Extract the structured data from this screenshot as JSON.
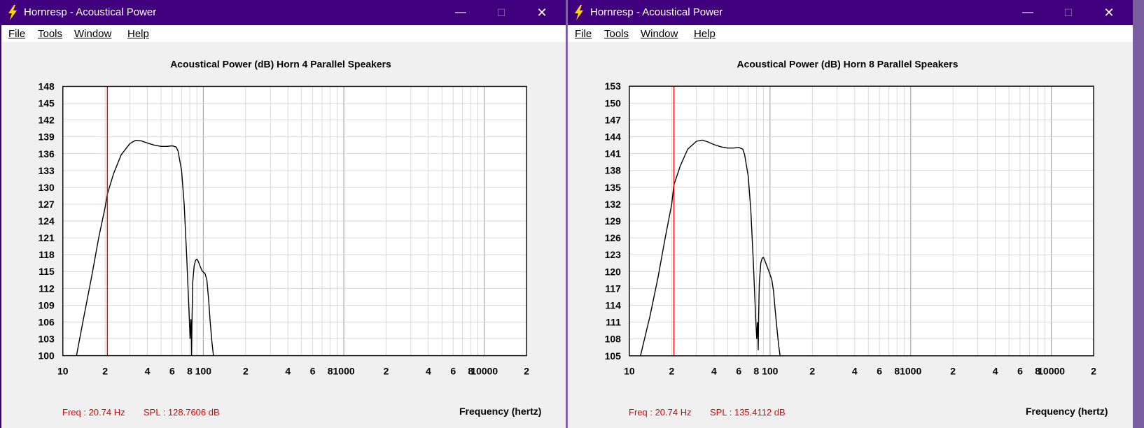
{
  "windows": [
    {
      "title": "Hornresp - Acoustical Power",
      "menu": [
        "File",
        "Tools",
        "Window",
        "Help"
      ],
      "freq_readout": "Freq : 20.74 Hz",
      "spl_readout": "SPL : 128.7606 dB",
      "chart_data": {
        "type": "line",
        "title": "Acoustical Power (dB)    Horn    4 Parallel Speakers",
        "xlabel": "Frequency (hertz)",
        "ylabel": "",
        "x_scale": "log",
        "xlim": [
          10,
          20000
        ],
        "ylim": [
          100,
          148
        ],
        "y_ticks": [
          100,
          103,
          106,
          109,
          112,
          115,
          118,
          121,
          124,
          127,
          130,
          133,
          136,
          139,
          142,
          145,
          148
        ],
        "x_tick_labels": [
          {
            "v": 10,
            "t": "10"
          },
          {
            "v": 20,
            "t": "2"
          },
          {
            "v": 40,
            "t": "4"
          },
          {
            "v": 60,
            "t": "6"
          },
          {
            "v": 80,
            "t": "8"
          },
          {
            "v": 100,
            "t": "100"
          },
          {
            "v": 200,
            "t": "2"
          },
          {
            "v": 400,
            "t": "4"
          },
          {
            "v": 600,
            "t": "6"
          },
          {
            "v": 800,
            "t": "8"
          },
          {
            "v": 1000,
            "t": "1000"
          },
          {
            "v": 2000,
            "t": "2"
          },
          {
            "v": 4000,
            "t": "4"
          },
          {
            "v": 6000,
            "t": "6"
          },
          {
            "v": 8000,
            "t": "8"
          },
          {
            "v": 10000,
            "t": "10000"
          },
          {
            "v": 20000,
            "t": "2"
          }
        ],
        "cursor_x": 20.74,
        "grid": true,
        "series": [
          {
            "x": [
              12.5,
              14,
              16,
              18,
              20,
              20.74,
              23,
              26,
              30,
              33,
              36,
              40,
              45,
              50,
              55,
              60,
              64,
              66,
              70,
              73,
              76,
              79,
              80.5,
              81.5,
              82,
              82.5,
              83,
              84,
              86,
              88,
              90,
              92,
              95,
              98,
              100,
              103,
              106,
              109,
              112,
              115,
              118,
              121,
              123
            ],
            "y": [
              100,
              106.5,
              114,
              121,
              126.5,
              128.8,
              132.5,
              135.8,
              137.8,
              138.4,
              138.3,
              137.9,
              137.5,
              137.3,
              137.3,
              137.4,
              137.2,
              136.5,
              133,
              127,
              118,
              108,
              103,
              106.5,
              105,
              100,
              106,
              113,
              116,
              117,
              117.2,
              116.8,
              115.9,
              115.1,
              114.9,
              114.6,
              113.5,
              110,
              106,
              102.5,
              100,
              98,
              96
            ]
          }
        ]
      }
    },
    {
      "title": "Hornresp - Acoustical Power",
      "menu": [
        "File",
        "Tools",
        "Window",
        "Help"
      ],
      "freq_readout": "Freq : 20.74 Hz",
      "spl_readout": "SPL : 135.4112 dB",
      "chart_data": {
        "type": "line",
        "title": "Acoustical Power (dB)    Horn    8 Parallel Speakers",
        "xlabel": "Frequency (hertz)",
        "ylabel": "",
        "x_scale": "log",
        "xlim": [
          10,
          20000
        ],
        "ylim": [
          105,
          153
        ],
        "y_ticks": [
          105,
          108,
          111,
          114,
          117,
          120,
          123,
          126,
          129,
          132,
          135,
          138,
          141,
          144,
          147,
          150,
          153
        ],
        "x_tick_labels": [
          {
            "v": 10,
            "t": "10"
          },
          {
            "v": 20,
            "t": "2"
          },
          {
            "v": 40,
            "t": "4"
          },
          {
            "v": 60,
            "t": "6"
          },
          {
            "v": 80,
            "t": "8"
          },
          {
            "v": 100,
            "t": "100"
          },
          {
            "v": 200,
            "t": "2"
          },
          {
            "v": 400,
            "t": "4"
          },
          {
            "v": 600,
            "t": "6"
          },
          {
            "v": 800,
            "t": "8"
          },
          {
            "v": 1000,
            "t": "1000"
          },
          {
            "v": 2000,
            "t": "2"
          },
          {
            "v": 4000,
            "t": "4"
          },
          {
            "v": 6000,
            "t": "6"
          },
          {
            "v": 8000,
            "t": "8"
          },
          {
            "v": 10000,
            "t": "10000"
          },
          {
            "v": 20000,
            "t": "2"
          }
        ],
        "cursor_x": 20.74,
        "grid": true,
        "series": [
          {
            "x": [
              12,
              14,
              16,
              18,
              20,
              20.74,
              23,
              26,
              30,
              33,
              36,
              40,
              45,
              50,
              55,
              60,
              64,
              66,
              70,
              73,
              76,
              79,
              80.5,
              81.5,
              82,
              82.5,
              83,
              84,
              86,
              88,
              90,
              92,
              95,
              98,
              100,
              103,
              106,
              109,
              112,
              115,
              118,
              121,
              123
            ],
            "y": [
              105,
              112,
              119,
              126,
              132,
              135.4,
              138.8,
              141.8,
              143.2,
              143.4,
              143.1,
              142.6,
              142.2,
              142,
              142,
              142.1,
              141.8,
              140.8,
              137,
              131,
              122,
              112,
              108,
              111,
              109.5,
              106,
              112,
              118,
              121.5,
              122.4,
              122.5,
              121.9,
              121,
              120.1,
              119.5,
              118.6,
              116.5,
              113,
              110,
              107,
              105,
              103,
              101
            ]
          }
        ]
      }
    }
  ],
  "colors": {
    "titlebar": "#40007e",
    "curve": "#000000",
    "cursor": "#ff0000",
    "grid": "#d0d0d0",
    "readout": "#e00000"
  },
  "icons": {
    "app": "lightning-bolt-icon",
    "minimize": "minimize-icon",
    "maximize": "maximize-icon",
    "close": "close-icon"
  }
}
